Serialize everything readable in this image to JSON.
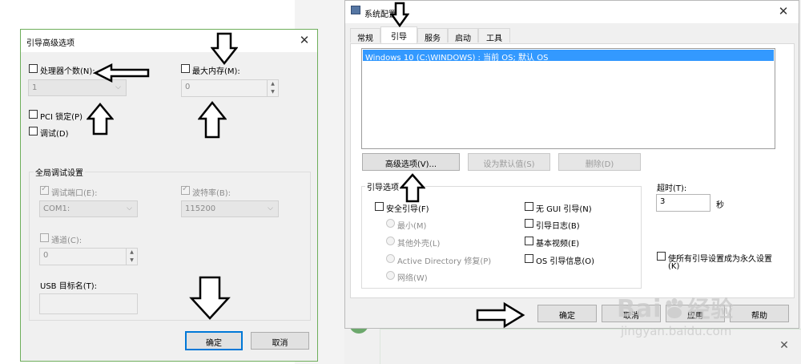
{
  "left_dialog": {
    "title": "引导高级选项",
    "proc_count_label": "处理器个数(N):",
    "proc_count_value": "1",
    "max_mem_label": "最大内存(M):",
    "max_mem_value": "0",
    "pci_lock_label": "PCI 锁定(P)",
    "debug_label": "调试(D)",
    "global_debug_group": "全局调试设置",
    "debug_port_label": "调试端口(E):",
    "debug_port_value": "COM1:",
    "baud_label": "波特率(B):",
    "baud_value": "115200",
    "channel_label": "通道(C):",
    "channel_value": "0",
    "usb_target_label": "USB 目标名(T):",
    "ok_label": "确定",
    "cancel_label": "取消"
  },
  "right_dialog": {
    "title": "系统配置",
    "tabs": [
      "常规",
      "引导",
      "服务",
      "启动",
      "工具"
    ],
    "boot_entry": "Windows 10 (C:\\WINDOWS) : 当前 OS; 默认 OS",
    "advanced_btn": "高级选项(V)...",
    "set_default_btn": "设为默认值(S)",
    "delete_btn": "删除(D)",
    "boot_options_group": "引导选项",
    "safe_boot_label": "安全引导(F)",
    "radio_minimal": "最小(M)",
    "radio_alt_shell": "其他外壳(L)",
    "radio_ad_repair": "Active Directory 修复(P)",
    "radio_network": "网络(W)",
    "no_gui_label": "无 GUI 引导(N)",
    "boot_log_label": "引导日志(B)",
    "base_video_label": "基本视频(E)",
    "os_boot_info_label": "OS 引导信息(O)",
    "timeout_label": "超时(T):",
    "timeout_value": "3",
    "timeout_unit": "秒",
    "permanent_label_1": "使所有引导设置成为永久设置",
    "permanent_label_2": "(K)",
    "ok_label": "确定",
    "cancel_label": "取消",
    "apply_label": "应用",
    "help_label": "帮助"
  },
  "watermark": {
    "brand": "Bai",
    "brand2": "经验",
    "url": "jingyan.baidu.com"
  },
  "icons": {
    "app_icon": "msconfig-icon",
    "close": "close-icon"
  }
}
